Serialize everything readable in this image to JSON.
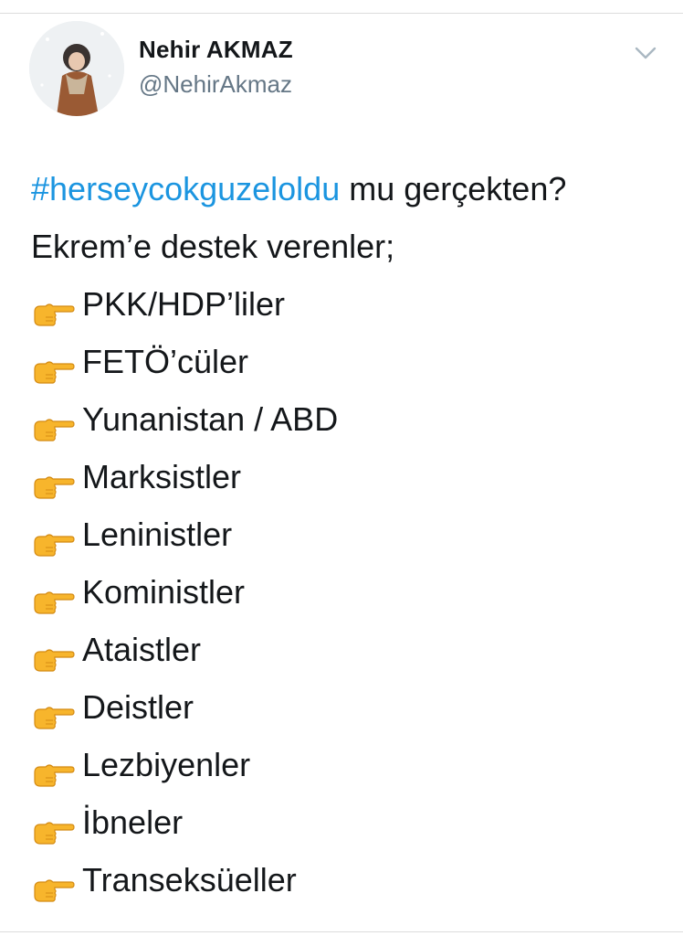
{
  "author": {
    "name": "Nehir AKMAZ",
    "handle": "@NehirAkmaz"
  },
  "icons": {
    "menu": "chevron-down-icon",
    "bullet": "backhand-index-pointing-right-icon"
  },
  "colors": {
    "hashtag": "#1b95e0",
    "text": "#14171a",
    "secondary": "#657786",
    "pointer_fill": "#f7b52c"
  },
  "tweet": {
    "hashtag": "#herseycokguzeloldu",
    "first_line_rest": " mu gerçekten?",
    "intro": "Ekrem’e destek verenler;",
    "items": [
      "PKK/HDP’liler",
      "FETÖ’cüler",
      "Yunanistan / ABD",
      "Marksistler",
      "Leninistler",
      "Koministler",
      "Ataistler",
      "Deistler",
      "Lezbiyenler",
      "İbneler",
      "Transeksüeller"
    ]
  }
}
